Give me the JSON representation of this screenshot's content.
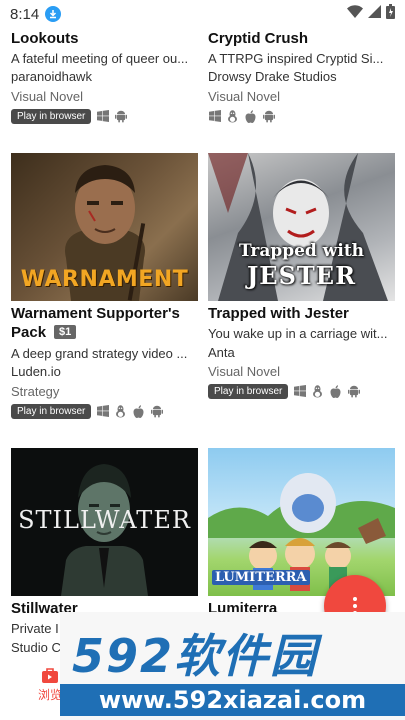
{
  "status_bar": {
    "time": "8:14"
  },
  "games": [
    {
      "title": "Lookouts",
      "description": "A fateful meeting of queer ou...",
      "author": "paranoidhawk",
      "genre": "Visual Novel",
      "browser_label": "Play in browser",
      "platforms": [
        "windows-icon",
        "android-icon"
      ]
    },
    {
      "title": "Cryptid Crush",
      "description": "A TTRPG inspired Cryptid Si...",
      "author": "Drowsy Drake Studios",
      "genre": "Visual Novel",
      "platforms": [
        "windows-icon",
        "linux-icon",
        "apple-icon",
        "android-icon"
      ]
    },
    {
      "title": "Warnament Supporter's Pack",
      "title_line1": "Warnament Supporter's",
      "title_line2": "Pack",
      "price": "$1",
      "thumb_text": "WARNAMENT",
      "description": "A deep grand strategy video ...",
      "author": "Luden.io",
      "genre": "Strategy",
      "browser_label": "Play in browser",
      "platforms": [
        "windows-icon",
        "linux-icon",
        "apple-icon",
        "android-icon"
      ]
    },
    {
      "title": "Trapped with Jester",
      "thumb_text_1": "Trapped with",
      "thumb_text_2": "JESTER",
      "description": "You wake up in a carriage wit...",
      "author": "Anta",
      "genre": "Visual Novel",
      "browser_label": "Play in browser",
      "platforms": [
        "windows-icon",
        "linux-icon",
        "apple-icon",
        "android-icon"
      ]
    },
    {
      "title": "Stillwater",
      "thumb_text": "STILLWATER",
      "description": "Private I",
      "author": "Studio C"
    },
    {
      "title": "Lumiterra",
      "thumb_text": "LUMITERRA"
    }
  ],
  "bottom_nav": {
    "browse_label": "浏览"
  },
  "watermark": {
    "brand": "592软件园",
    "url": "www.592xiazai.com"
  },
  "colors": {
    "fab": "#f0483e",
    "tag": "#4a4a4a",
    "price": "#666666",
    "watermark_blue": "#1f6fb5"
  }
}
